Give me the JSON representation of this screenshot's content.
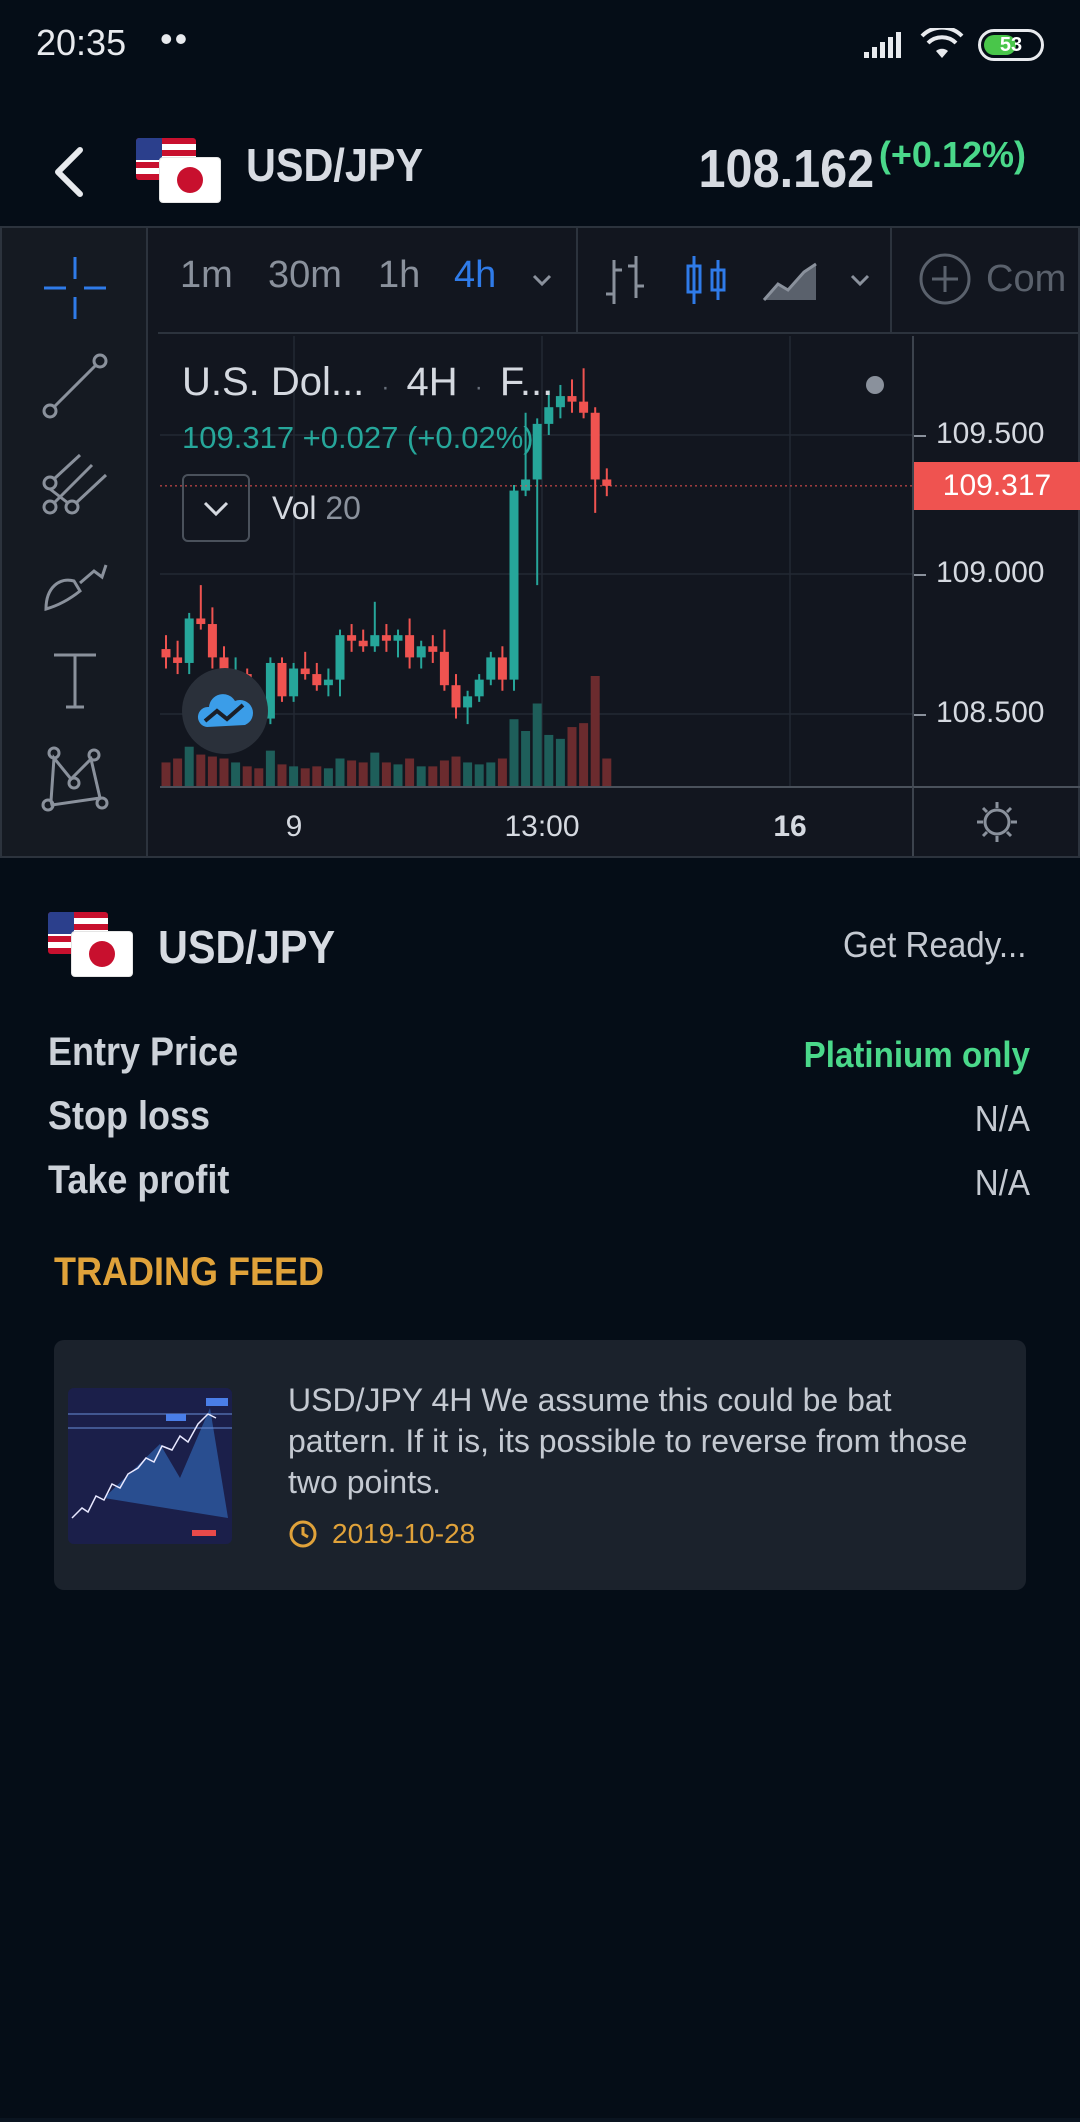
{
  "status_bar": {
    "time": "20:35",
    "dots": "••",
    "battery_level": "53",
    "battery_fraction": 0.53
  },
  "header": {
    "pair": "USD/JPY",
    "price": "108.162",
    "change": "(+0.12%)"
  },
  "chart": {
    "timeframes": [
      {
        "label": "1m",
        "active": false
      },
      {
        "label": "30m",
        "active": false
      },
      {
        "label": "1h",
        "active": false
      },
      {
        "label": "4h",
        "active": true
      }
    ],
    "compare_label": "Com",
    "legend": {
      "symbol": "U.S. Dol...",
      "interval": "4H",
      "exchange": "F...",
      "sep": "·",
      "values": "109.317  +0.027 (+0.02%)",
      "vol_label": "Vol",
      "vol_value": "20"
    },
    "price_labels": [
      "109.500",
      "109.000",
      "108.500"
    ],
    "last_price": "109.317",
    "time_labels": [
      "9",
      "13:00",
      "16"
    ],
    "colors": {
      "up": "#26a69a",
      "down": "#ef5350",
      "accent": "#2f7be8"
    }
  },
  "chart_data": {
    "type": "candlestick",
    "title": "U.S. Dol... · 4H · F...",
    "y_ticks": [
      108.5,
      109.0,
      109.5
    ],
    "x_ticks": [
      "9",
      "13:00",
      "16"
    ],
    "last": 109.317,
    "candles": [
      {
        "o": 108.73,
        "h": 108.78,
        "l": 108.66,
        "c": 108.7
      },
      {
        "o": 108.7,
        "h": 108.76,
        "l": 108.64,
        "c": 108.68
      },
      {
        "o": 108.68,
        "h": 108.86,
        "l": 108.64,
        "c": 108.84
      },
      {
        "o": 108.84,
        "h": 108.96,
        "l": 108.8,
        "c": 108.82
      },
      {
        "o": 108.82,
        "h": 108.88,
        "l": 108.66,
        "c": 108.7
      },
      {
        "o": 108.7,
        "h": 108.74,
        "l": 108.58,
        "c": 108.62
      },
      {
        "o": 108.62,
        "h": 108.7,
        "l": 108.56,
        "c": 108.64
      },
      {
        "o": 108.64,
        "h": 108.66,
        "l": 108.48,
        "c": 108.52
      },
      {
        "o": 108.52,
        "h": 108.56,
        "l": 108.44,
        "c": 108.48
      },
      {
        "o": 108.48,
        "h": 108.7,
        "l": 108.46,
        "c": 108.68
      },
      {
        "o": 108.68,
        "h": 108.7,
        "l": 108.54,
        "c": 108.56
      },
      {
        "o": 108.56,
        "h": 108.68,
        "l": 108.54,
        "c": 108.66
      },
      {
        "o": 108.66,
        "h": 108.72,
        "l": 108.62,
        "c": 108.64
      },
      {
        "o": 108.64,
        "h": 108.68,
        "l": 108.58,
        "c": 108.6
      },
      {
        "o": 108.6,
        "h": 108.66,
        "l": 108.56,
        "c": 108.62
      },
      {
        "o": 108.62,
        "h": 108.8,
        "l": 108.56,
        "c": 108.78
      },
      {
        "o": 108.78,
        "h": 108.82,
        "l": 108.72,
        "c": 108.76
      },
      {
        "o": 108.76,
        "h": 108.8,
        "l": 108.72,
        "c": 108.74
      },
      {
        "o": 108.74,
        "h": 108.9,
        "l": 108.72,
        "c": 108.78
      },
      {
        "o": 108.78,
        "h": 108.82,
        "l": 108.72,
        "c": 108.76
      },
      {
        "o": 108.76,
        "h": 108.8,
        "l": 108.7,
        "c": 108.78
      },
      {
        "o": 108.78,
        "h": 108.84,
        "l": 108.66,
        "c": 108.7
      },
      {
        "o": 108.7,
        "h": 108.76,
        "l": 108.66,
        "c": 108.74
      },
      {
        "o": 108.74,
        "h": 108.78,
        "l": 108.68,
        "c": 108.72
      },
      {
        "o": 108.72,
        "h": 108.8,
        "l": 108.58,
        "c": 108.6
      },
      {
        "o": 108.6,
        "h": 108.64,
        "l": 108.48,
        "c": 108.52
      },
      {
        "o": 108.52,
        "h": 108.58,
        "l": 108.46,
        "c": 108.56
      },
      {
        "o": 108.56,
        "h": 108.64,
        "l": 108.54,
        "c": 108.62
      },
      {
        "o": 108.62,
        "h": 108.72,
        "l": 108.6,
        "c": 108.7
      },
      {
        "o": 108.7,
        "h": 108.74,
        "l": 108.58,
        "c": 108.62
      },
      {
        "o": 108.62,
        "h": 109.32,
        "l": 108.58,
        "c": 109.3
      },
      {
        "o": 109.3,
        "h": 109.58,
        "l": 109.28,
        "c": 109.34
      },
      {
        "o": 109.34,
        "h": 109.56,
        "l": 108.96,
        "c": 109.54
      },
      {
        "o": 109.54,
        "h": 109.66,
        "l": 109.5,
        "c": 109.6
      },
      {
        "o": 109.6,
        "h": 109.68,
        "l": 109.56,
        "c": 109.64
      },
      {
        "o": 109.64,
        "h": 109.7,
        "l": 109.58,
        "c": 109.62
      },
      {
        "o": 109.62,
        "h": 109.74,
        "l": 109.56,
        "c": 109.58
      },
      {
        "o": 109.58,
        "h": 109.6,
        "l": 109.22,
        "c": 109.34
      },
      {
        "o": 109.34,
        "h": 109.38,
        "l": 109.28,
        "c": 109.317
      }
    ],
    "volume": [
      12,
      14,
      20,
      16,
      15,
      14,
      12,
      10,
      9,
      18,
      11,
      10,
      9,
      10,
      9,
      14,
      13,
      12,
      17,
      12,
      11,
      14,
      10,
      10,
      13,
      15,
      12,
      11,
      12,
      14,
      34,
      28,
      42,
      26,
      24,
      30,
      32,
      56,
      14
    ]
  },
  "signal": {
    "pair": "USD/JPY",
    "status": "Get Ready...",
    "rows": [
      {
        "label": "Entry Price",
        "value": "Platinium only"
      },
      {
        "label": "Stop loss",
        "value": "N/A"
      },
      {
        "label": "Take profit",
        "value": "N/A"
      }
    ]
  },
  "feed": {
    "title": "TRADING FEED",
    "items": [
      {
        "text": "USD/JPY 4H We assume this could be bat pattern. If it is, its possible to reverse from those two points.",
        "date": "2019-10-28"
      }
    ]
  }
}
